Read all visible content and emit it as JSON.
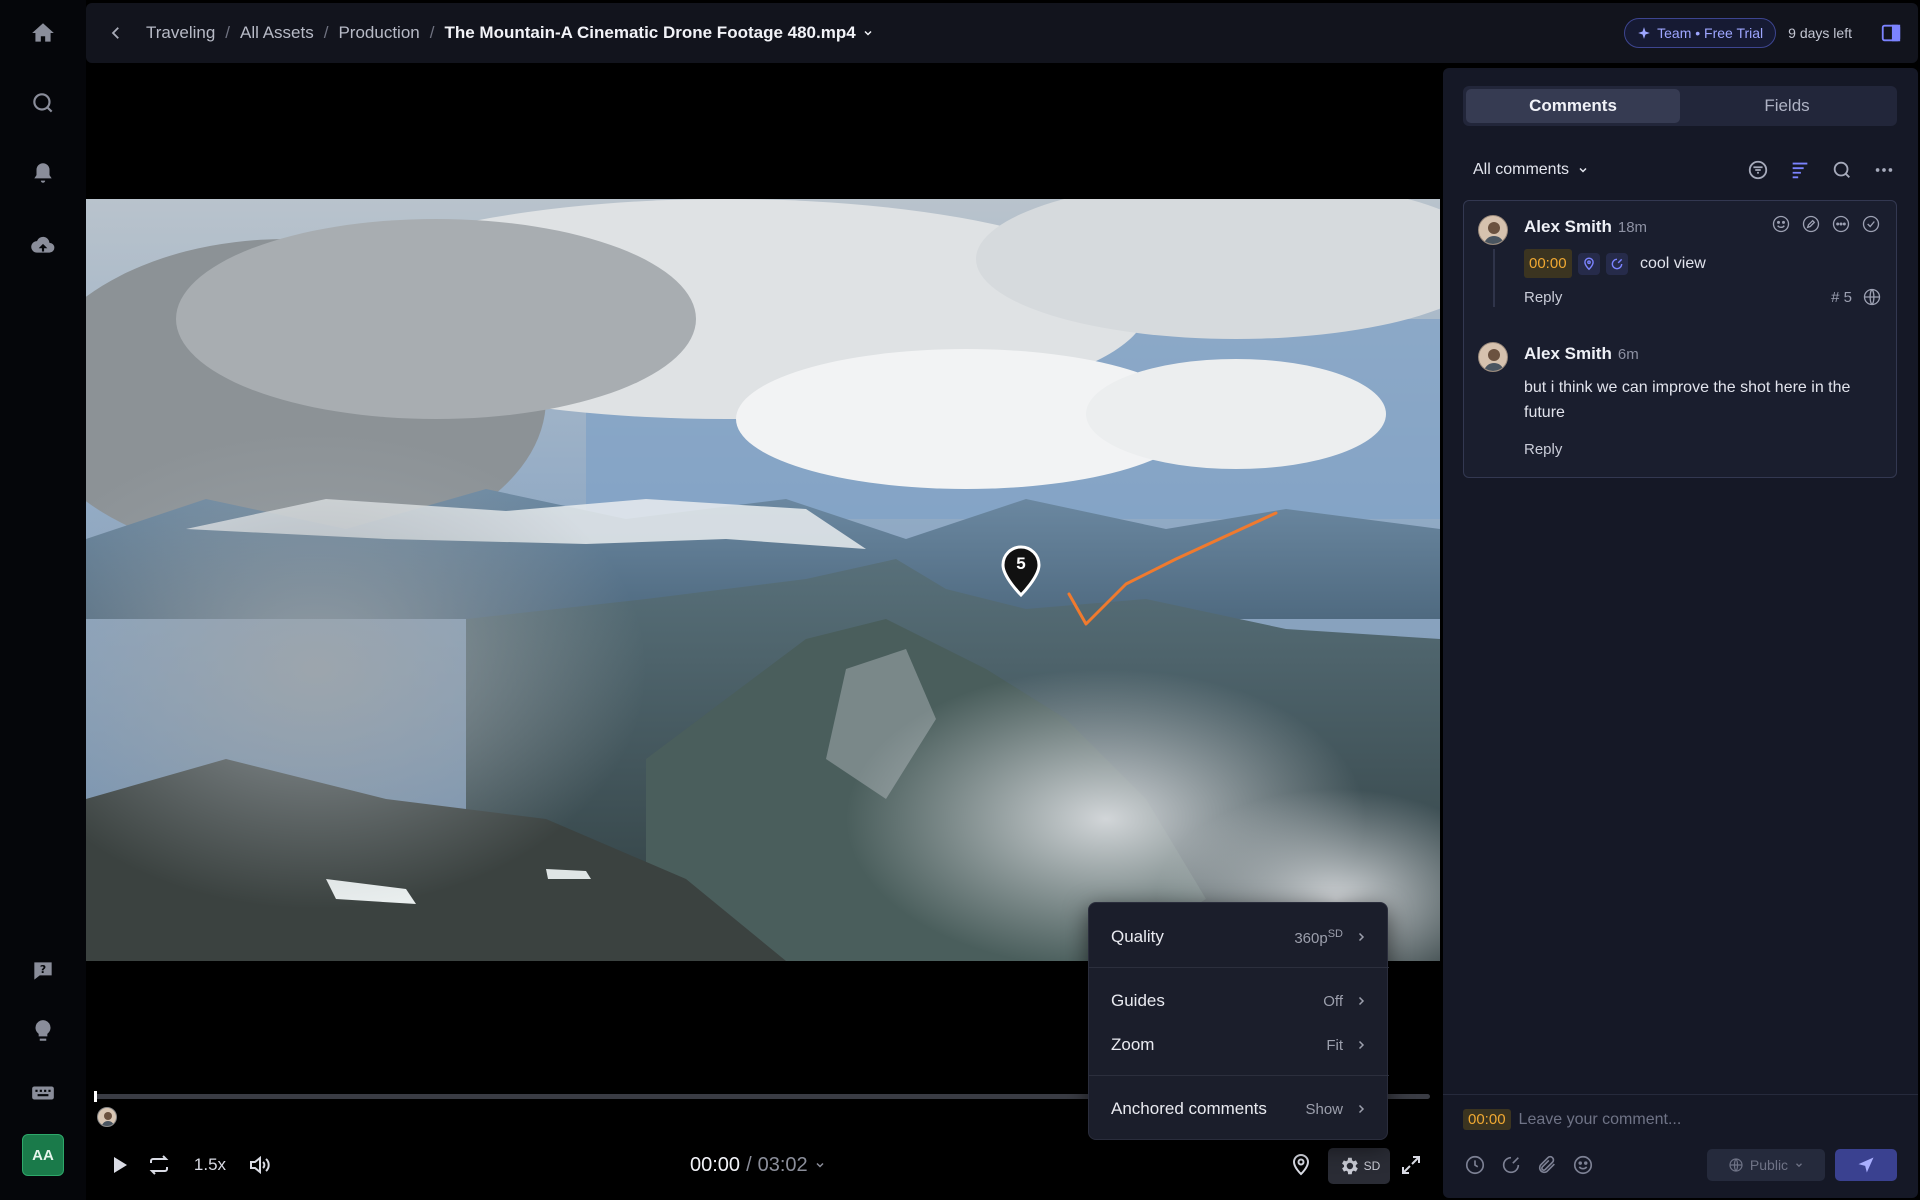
{
  "breadcrumb": {
    "items": [
      "Traveling",
      "All Assets",
      "Production"
    ],
    "separator": "/",
    "current": "The Mountain-A Cinematic Drone Footage 480.mp4"
  },
  "topbar": {
    "trial_badge": "Team • Free Trial",
    "days_left": "9 days left"
  },
  "rail": {
    "icons": [
      "home-icon",
      "search-icon",
      "bell-icon",
      "upload-cloud-icon",
      "help-icon",
      "lightbulb-icon",
      "keyboard-icon"
    ],
    "user_initials": "AA"
  },
  "video": {
    "annotation_pin_number": "5",
    "annotation_color": "#f07a2e"
  },
  "player": {
    "speed": "1.5x",
    "current_time": "00:00",
    "time_separator": "/",
    "duration": "03:02",
    "quality_badge": "SD",
    "progress": 0
  },
  "settings_menu": {
    "items": [
      {
        "label": "Quality",
        "value": "360p",
        "sup": "SD"
      },
      {
        "label": "Guides",
        "value": "Off"
      },
      {
        "label": "Zoom",
        "value": "Fit"
      },
      {
        "label": "Anchored comments",
        "value": "Show"
      }
    ]
  },
  "panel": {
    "tabs": [
      {
        "label": "Comments",
        "active": true
      },
      {
        "label": "Fields",
        "active": false
      }
    ],
    "filter_label": "All comments",
    "comments": [
      {
        "author": "Alex Smith",
        "time": "18m",
        "timecode": "00:00",
        "text": "cool view",
        "reply": "Reply",
        "number": "# 5"
      },
      {
        "author": "Alex Smith",
        "time": "6m",
        "text": "but i think we can improve the shot here in the future",
        "reply": "Reply"
      }
    ],
    "composer": {
      "timecode": "00:00",
      "placeholder": "Leave your comment...",
      "visibility": "Public"
    }
  },
  "colors": {
    "accent": "#7b83ff",
    "timecode": "#f0a832",
    "panel_bg": "#151826"
  }
}
